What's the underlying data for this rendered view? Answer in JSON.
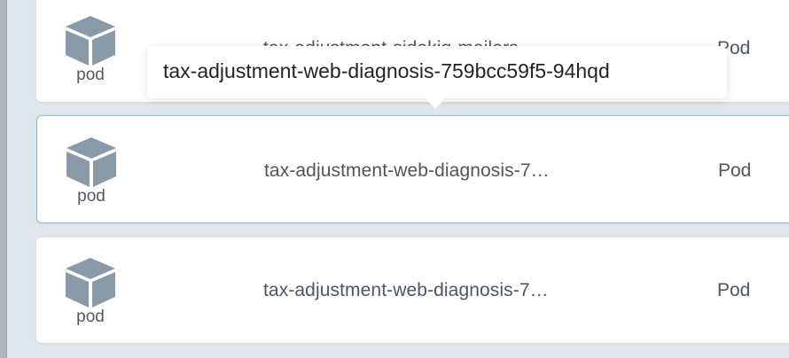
{
  "colors": {
    "background": "#dfe6ec",
    "card": "#ffffff",
    "selected_border": "#8ac3cf",
    "icon": "#8a9aa8",
    "text": "#4d565e"
  },
  "tooltip": {
    "text": "tax-adjustment-web-diagnosis-759bcc59f5-94hqd"
  },
  "rows": [
    {
      "icon": "cube-icon",
      "kind": "pod",
      "name": "tax-adjustment-sidekiq-mailers",
      "type": "Pod"
    },
    {
      "icon": "cube-icon",
      "kind": "pod",
      "name": "tax-adjustment-web-diagnosis-7…",
      "type": "Pod"
    },
    {
      "icon": "cube-icon",
      "kind": "pod",
      "name": "tax-adjustment-web-diagnosis-7…",
      "type": "Pod"
    }
  ]
}
